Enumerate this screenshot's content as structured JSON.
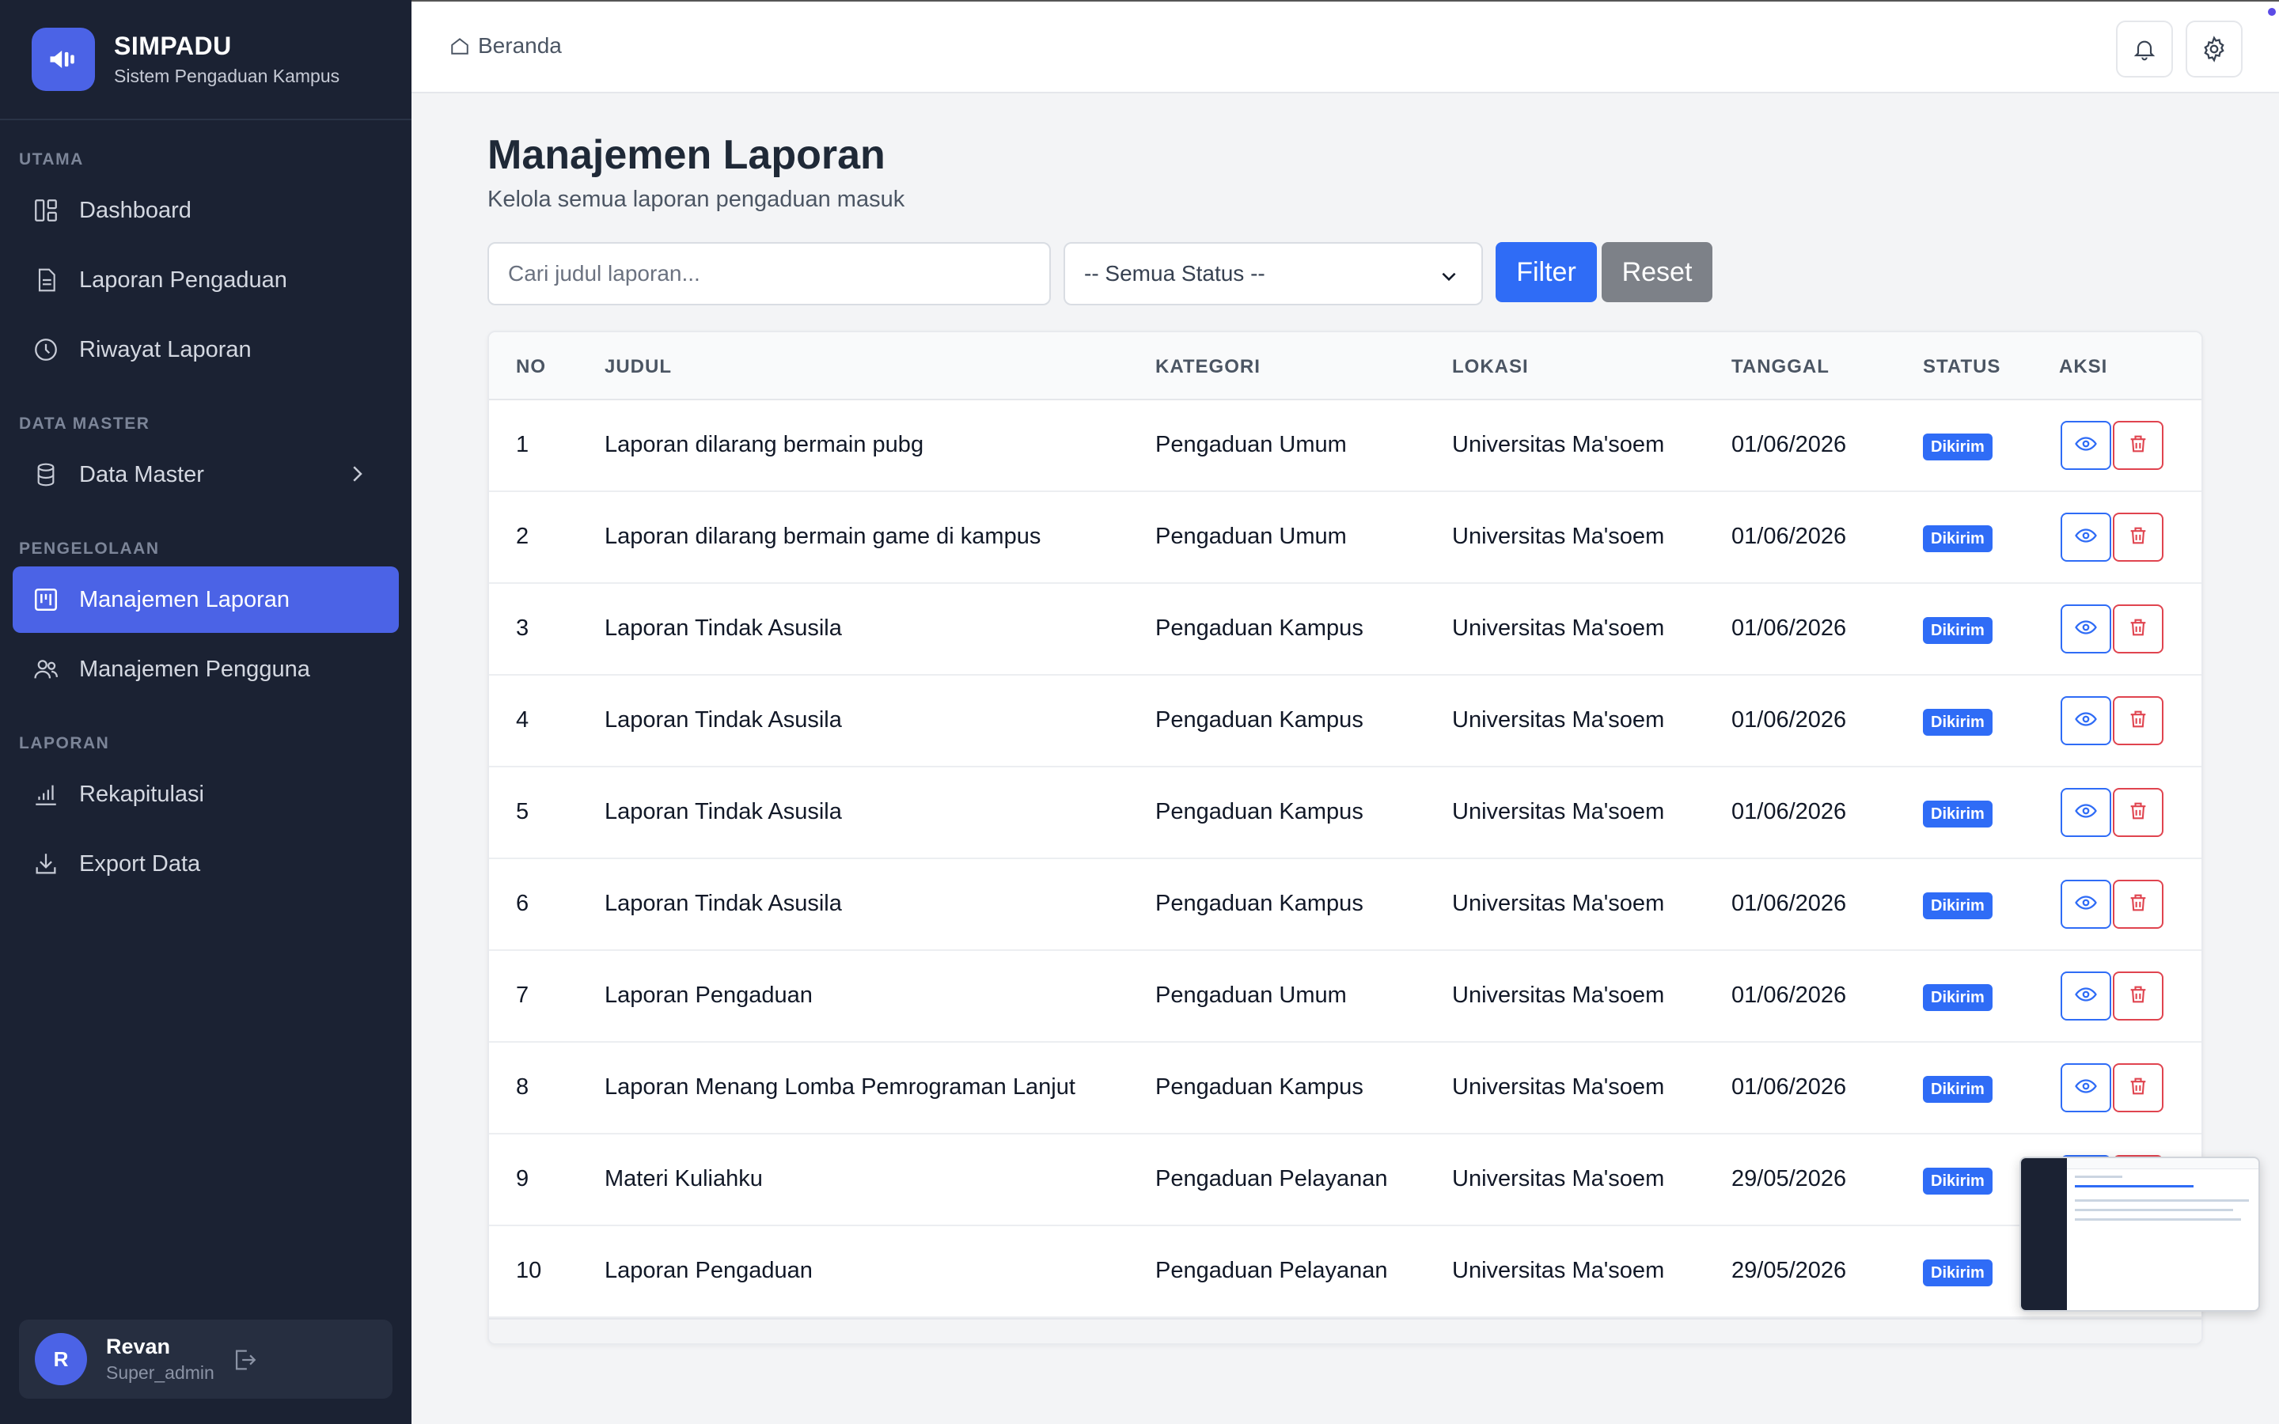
{
  "brand": {
    "title": "SIMPADU",
    "subtitle": "Sistem Pengaduan Kampus"
  },
  "sidebar": {
    "sections": {
      "utama": "UTAMA",
      "data_master": "DATA MASTER",
      "pengelolaan": "PENGELOLAAN",
      "laporan": "LAPORAN"
    },
    "items": {
      "dashboard": "Dashboard",
      "laporan_pengaduan": "Laporan Pengaduan",
      "riwayat_laporan": "Riwayat Laporan",
      "data_master": "Data Master",
      "manajemen_laporan": "Manajemen Laporan",
      "manajemen_pengguna": "Manajemen Pengguna",
      "rekapitulasi": "Rekapitulasi",
      "export_data": "Export Data"
    },
    "active": "manajemen_laporan"
  },
  "user": {
    "initial": "R",
    "name": "Revan",
    "role": "Super_admin"
  },
  "header": {
    "breadcrumb": "Beranda"
  },
  "page": {
    "title": "Manajemen Laporan",
    "subtitle": "Kelola semua laporan pengaduan masuk"
  },
  "filters": {
    "search_placeholder": "Cari judul laporan...",
    "search_value": "",
    "status_selected": "-- Semua Status --",
    "filter_label": "Filter",
    "reset_label": "Reset"
  },
  "table": {
    "columns": {
      "no": "NO",
      "judul": "JUDUL",
      "kategori": "KATEGORI",
      "lokasi": "LOKASI",
      "tanggal": "TANGGAL",
      "status": "STATUS",
      "aksi": "AKSI"
    },
    "rows": [
      {
        "no": "1",
        "judul": "Laporan dilarang bermain pubg",
        "kategori": "Pengaduan Umum",
        "lokasi": "Universitas Ma'soem",
        "tanggal": "01/06/2026",
        "status": "Dikirim"
      },
      {
        "no": "2",
        "judul": "Laporan dilarang bermain game di kampus",
        "kategori": "Pengaduan Umum",
        "lokasi": "Universitas Ma'soem",
        "tanggal": "01/06/2026",
        "status": "Dikirim"
      },
      {
        "no": "3",
        "judul": "Laporan Tindak Asusila",
        "kategori": "Pengaduan Kampus",
        "lokasi": "Universitas Ma'soem",
        "tanggal": "01/06/2026",
        "status": "Dikirim"
      },
      {
        "no": "4",
        "judul": "Laporan Tindak Asusila",
        "kategori": "Pengaduan Kampus",
        "lokasi": "Universitas Ma'soem",
        "tanggal": "01/06/2026",
        "status": "Dikirim"
      },
      {
        "no": "5",
        "judul": "Laporan Tindak Asusila",
        "kategori": "Pengaduan Kampus",
        "lokasi": "Universitas Ma'soem",
        "tanggal": "01/06/2026",
        "status": "Dikirim"
      },
      {
        "no": "6",
        "judul": "Laporan Tindak Asusila",
        "kategori": "Pengaduan Kampus",
        "lokasi": "Universitas Ma'soem",
        "tanggal": "01/06/2026",
        "status": "Dikirim"
      },
      {
        "no": "7",
        "judul": "Laporan Pengaduan",
        "kategori": "Pengaduan Umum",
        "lokasi": "Universitas Ma'soem",
        "tanggal": "01/06/2026",
        "status": "Dikirim"
      },
      {
        "no": "8",
        "judul": "Laporan Menang Lomba Pemrograman Lanjut",
        "kategori": "Pengaduan Kampus",
        "lokasi": "Universitas Ma'soem",
        "tanggal": "01/06/2026",
        "status": "Dikirim"
      },
      {
        "no": "9",
        "judul": "Materi Kuliahku",
        "kategori": "Pengaduan Pelayanan",
        "lokasi": "Universitas Ma'soem",
        "tanggal": "29/05/2026",
        "status": "Dikirim"
      },
      {
        "no": "10",
        "judul": "Laporan Pengaduan",
        "kategori": "Pengaduan Pelayanan",
        "lokasi": "Universitas Ma'soem",
        "tanggal": "29/05/2026",
        "status": "Dikirim"
      }
    ]
  },
  "colors": {
    "sidebar_bg": "#1b2233",
    "accent": "#4b63e6",
    "primary_button": "#2f6cf6",
    "reset_button": "#7d8188",
    "danger": "#e0444f"
  },
  "icons": {
    "brand": "megaphone-icon",
    "dashboard": "layout-grid-icon",
    "laporan_pengaduan": "document-icon",
    "riwayat_laporan": "clock-icon",
    "data_master": "database-icon",
    "manajemen_laporan": "kanban-icon",
    "manajemen_pengguna": "users-icon",
    "rekapitulasi": "bar-chart-icon",
    "export_data": "download-icon",
    "breadcrumb": "home-icon",
    "notification": "bell-icon",
    "settings": "gear-icon",
    "view": "eye-icon",
    "delete": "trash-icon",
    "logout": "logout-icon"
  }
}
